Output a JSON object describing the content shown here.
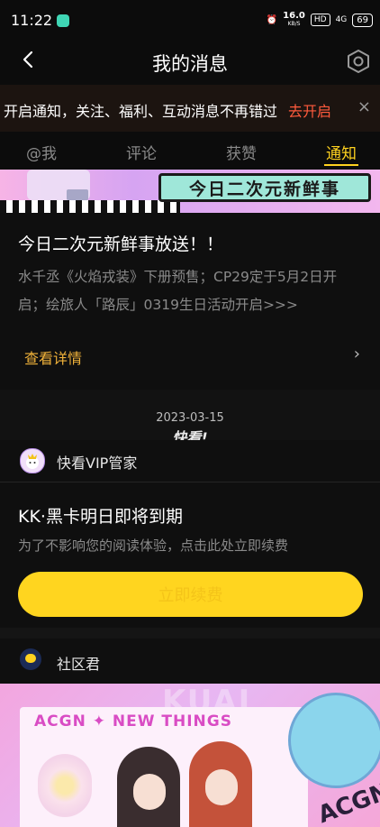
{
  "status_bar": {
    "time": "11:22",
    "speed": "16.0",
    "speed_unit": "KB/S",
    "hd_badge": "HD",
    "network": "4G",
    "battery": "69"
  },
  "nav": {
    "title": "我的消息",
    "back_icon": "chevron-left-icon",
    "settings_icon": "hexagon-settings-icon"
  },
  "notice": {
    "text": "开启通知，关注、福利、互动消息不再错过",
    "action": "去开启",
    "close": "×"
  },
  "tabs": {
    "items": [
      {
        "label": "@我"
      },
      {
        "label": "评论"
      },
      {
        "label": "获赞"
      },
      {
        "label": "通知"
      }
    ],
    "active_index": 3
  },
  "banner": {
    "title": "今日二次元新鲜事"
  },
  "news_card": {
    "headline": "今日二次元新鲜事放送！！",
    "description": "水千丞《火焰戎装》下册预售；CP29定于5月2日开启；绘旅人「路辰」0319生日活动开启>>>",
    "more_label": "查看详情",
    "chevron": "›"
  },
  "date_separator": {
    "date": "2023-03-15",
    "stamp": "快看!"
  },
  "vip_card": {
    "sender": "快看VIP管家",
    "title": "KK·黑卡明日即将到期",
    "description": "为了不影响您的阅读体验，点击此处立即续费",
    "button_label": "立即续费"
  },
  "community": {
    "sender": "社区君"
  },
  "poster": {
    "title": "ACGN ✦ NEW THINGS",
    "watermark": "KUAI",
    "corner": "ACGN"
  },
  "colors": {
    "accent_yellow": "#ffd21f",
    "notice_link": "#ff5a3c",
    "more_link": "#f0b23a",
    "background": "#0c0c0c"
  }
}
